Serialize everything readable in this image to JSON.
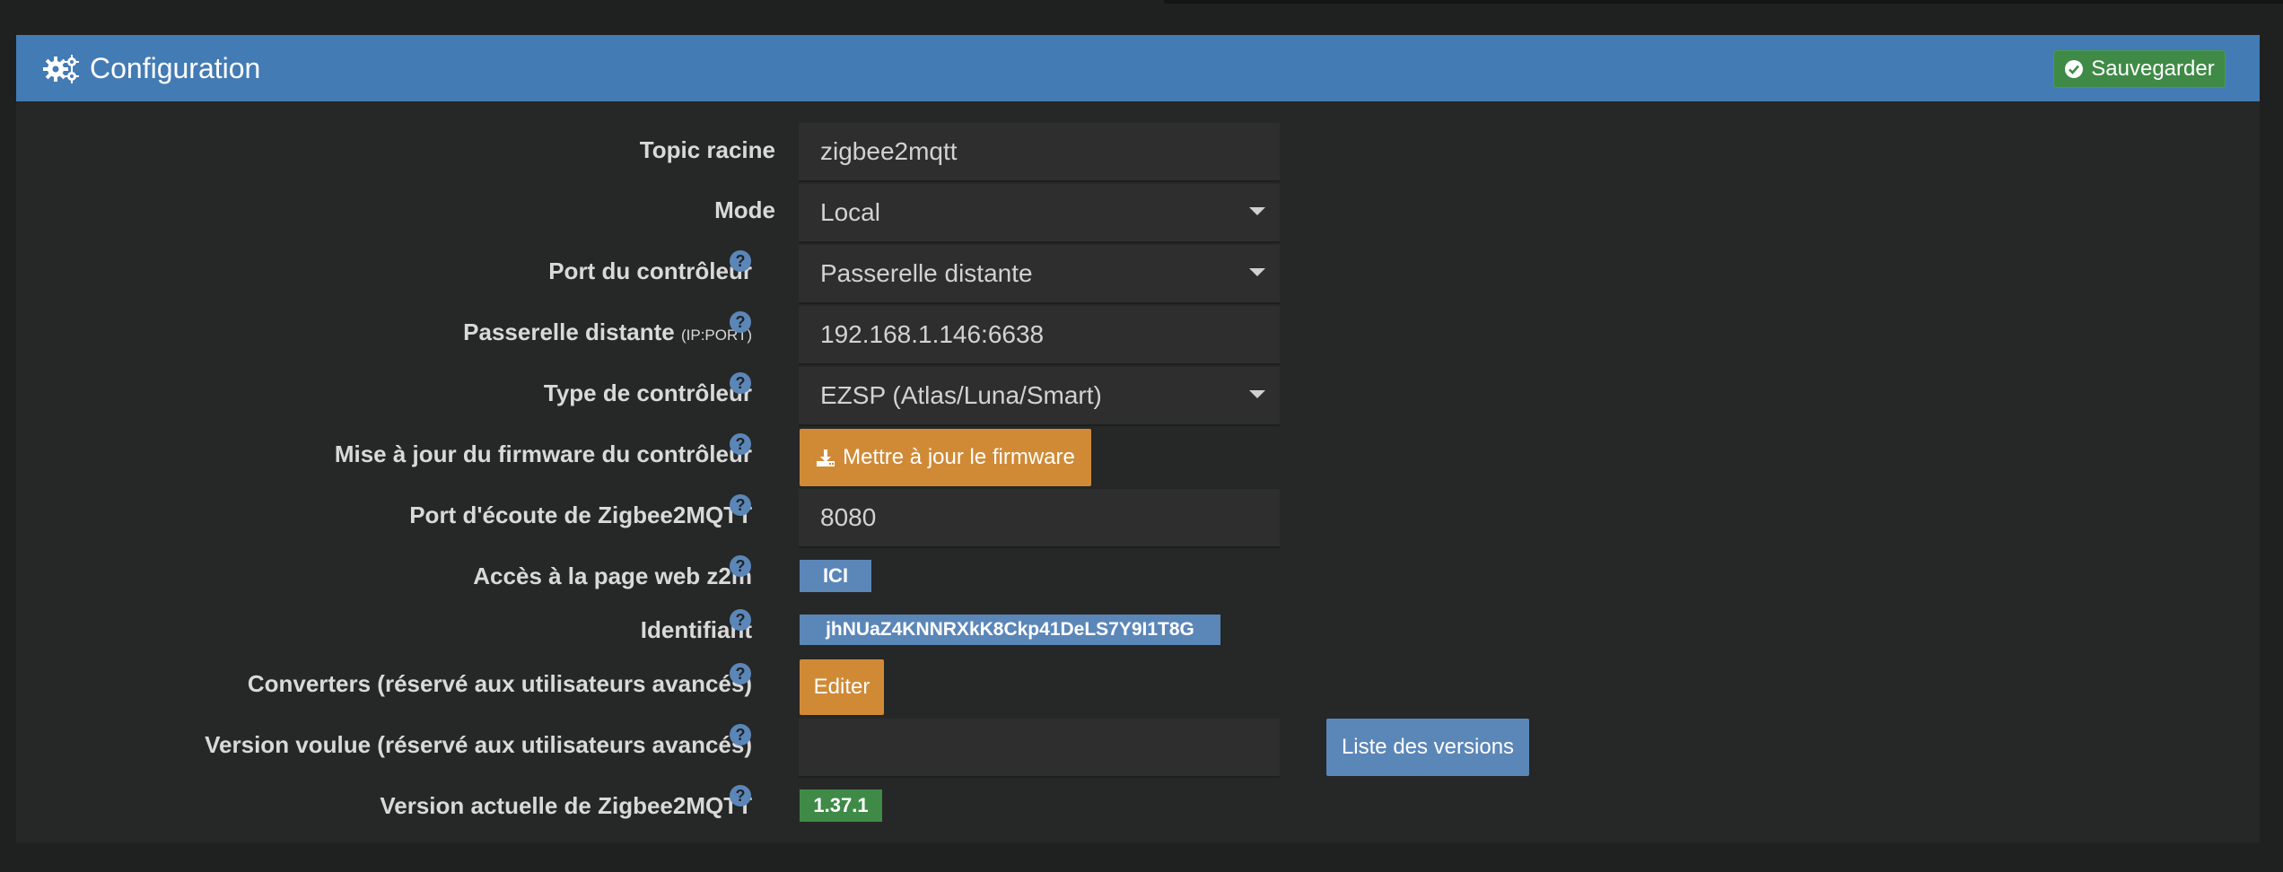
{
  "header": {
    "title": "Configuration",
    "title_icon": "gears-icon",
    "save_label": "Sauvegarder",
    "save_icon": "check-circle-icon"
  },
  "colors": {
    "header_bg": "#437bb5",
    "save_green": "#3f8a47",
    "orange": "#d08a36",
    "blue_label": "#5b86b8"
  },
  "fields": {
    "topic": {
      "label": "Topic racine",
      "value": "zigbee2mqtt"
    },
    "mode": {
      "label": "Mode",
      "value": "Local"
    },
    "port_controller": {
      "label": "Port du contrôleur",
      "value": "Passerelle distante"
    },
    "remote_gateway": {
      "label": "Passerelle distante",
      "label_suffix": "(IP:PORT)",
      "value": "192.168.1.146:6638"
    },
    "controller_type": {
      "label": "Type de contrôleur",
      "value": "EZSP (Atlas/Luna/Smart)"
    },
    "firmware": {
      "label": "Mise à jour du firmware du contrôleur",
      "button": "Mettre à jour le firmware"
    },
    "listen_port": {
      "label": "Port d'écoute de Zigbee2MQTT",
      "value": "8080"
    },
    "web_access": {
      "label": "Accès à la page web z2m",
      "link": "ICI"
    },
    "identifier": {
      "label": "Identifiant",
      "value": "jhNUaZ4KNNRXkK8Ckp41DeLS7Y9I1T8G"
    },
    "converters": {
      "label": "Converters (réservé aux utilisateurs avancés)",
      "button": "Editer"
    },
    "wanted_version": {
      "label": "Version voulue (réservé aux utilisateurs avancés)",
      "value": "",
      "button": "Liste des versions"
    },
    "current_version": {
      "label": "Version actuelle de Zigbee2MQTT",
      "value": "1.37.1"
    }
  },
  "help_glyph": "?"
}
